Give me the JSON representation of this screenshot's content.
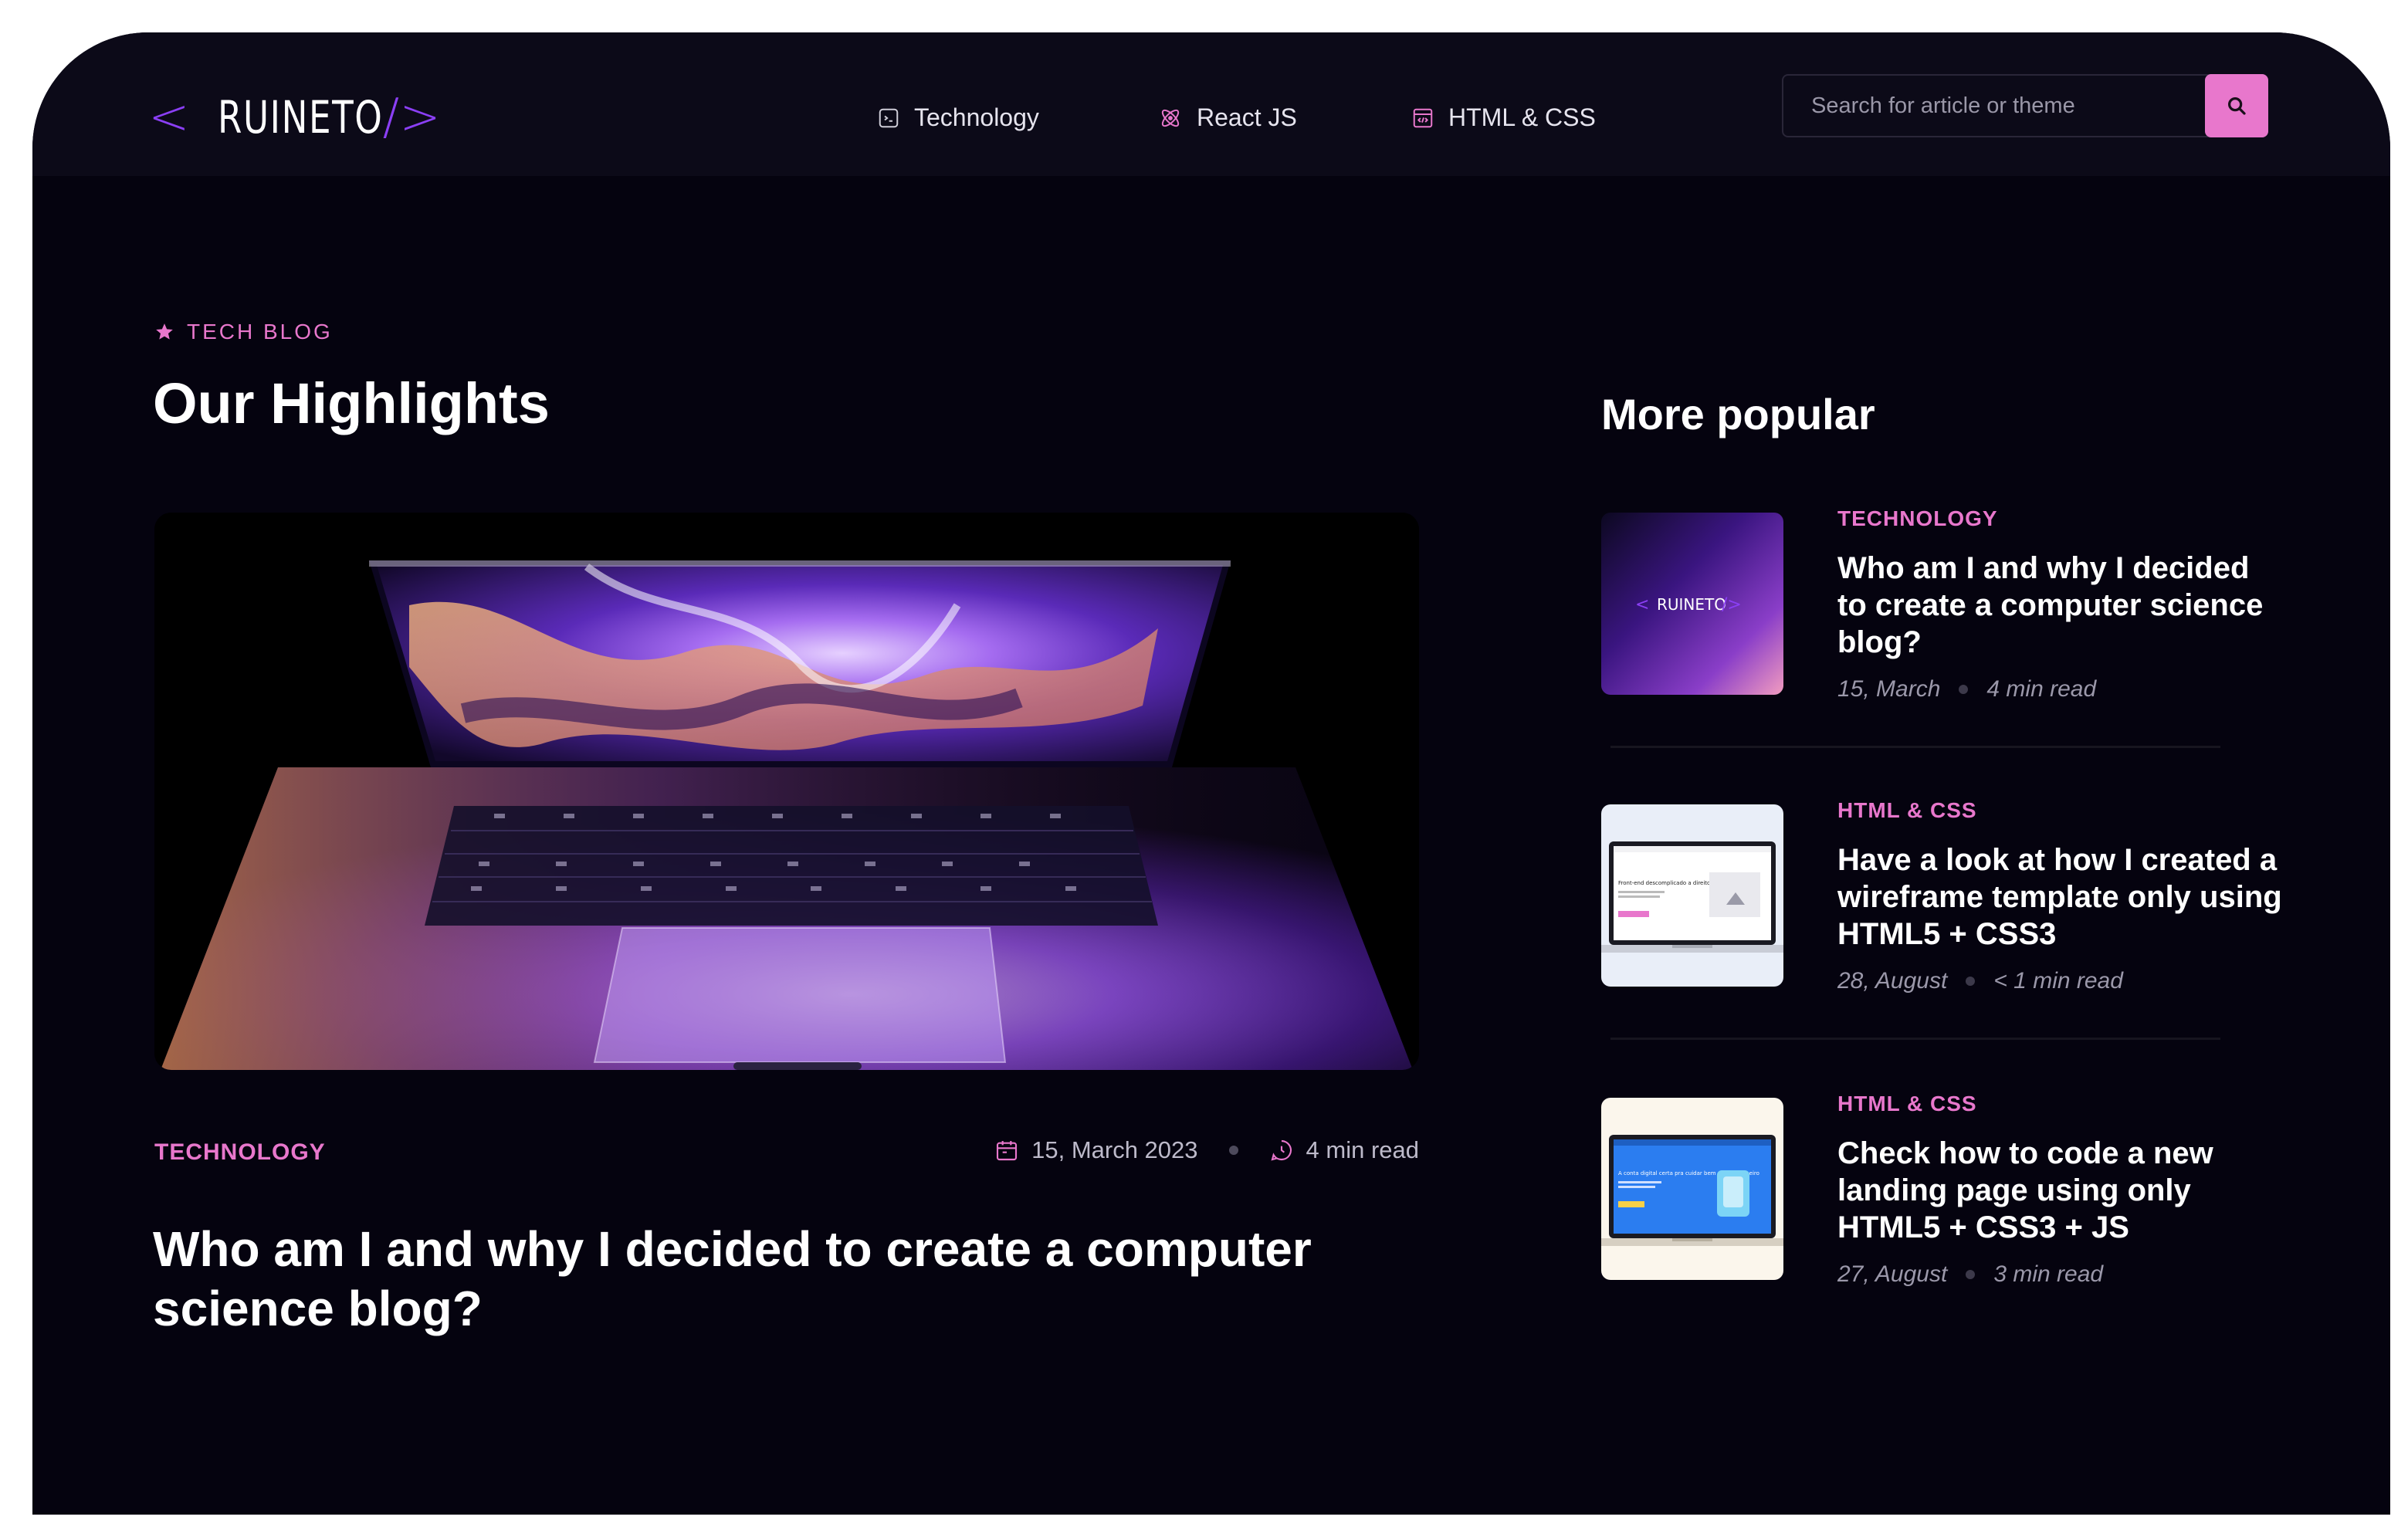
{
  "header": {
    "logo": {
      "left_bracket": "<",
      "word": "RUINETO",
      "right_bracket": "/>"
    },
    "nav": [
      {
        "label": "Technology",
        "icon": "terminal-icon"
      },
      {
        "label": "React JS",
        "icon": "react-atom-icon"
      },
      {
        "label": "HTML & CSS",
        "icon": "code-window-icon"
      }
    ],
    "search": {
      "placeholder": "Search for article or theme",
      "value": "",
      "icon": "search-icon"
    }
  },
  "highlights": {
    "kicker": "TECH BLOG",
    "title": "Our Highlights",
    "featured": {
      "category": "TECHNOLOGY",
      "date": "15, March 2023",
      "read_time": "4 min read",
      "title": "Who am I and why I decided to create a computer science blog?"
    }
  },
  "popular": {
    "title": "More popular",
    "items": [
      {
        "category": "TECHNOLOGY",
        "title": "Who am I and why I decided to create a computer science blog?",
        "date": "15, March",
        "read_time": "4 min read",
        "thumb_text": "RUINETO"
      },
      {
        "category": "HTML & CSS",
        "title": "Have a look at how I created a wireframe template only using HTML5 + CSS3",
        "date": "28, August",
        "read_time": "< 1 min read",
        "thumb_text": "Front-end descomplicado a direito ao ponto!"
      },
      {
        "category": "HTML & CSS",
        "title": "Check how to code a new landing page using only HTML5 + CSS3 + JS",
        "date": "27, August",
        "read_time": "3 min read",
        "thumb_text": "A conta digital certa pra cuidar bem do seu dinheiro"
      }
    ]
  },
  "colors": {
    "background": "#05030f",
    "header": "#0c0a18",
    "accent_pink": "#e877cc",
    "accent_purple": "#8b3ff5"
  }
}
